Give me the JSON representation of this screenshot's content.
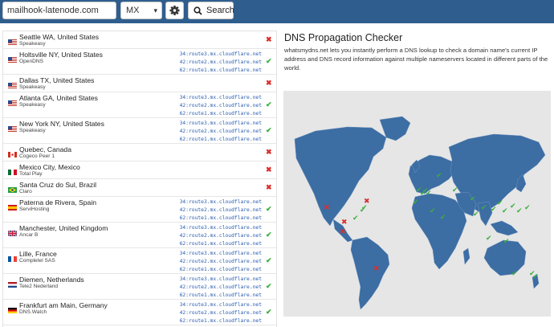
{
  "search": {
    "domain_value": "mailhook-latenode.com",
    "record_type": "MX",
    "search_label": "Search"
  },
  "results": [
    {
      "location": "Seattle WA, United States",
      "isp": "Speakeasy",
      "flag": "us",
      "records": [],
      "status": "fail"
    },
    {
      "location": "Holtsville NY, United States",
      "isp": "OpenDNS",
      "flag": "us",
      "records": [
        "34:route3.mx.cloudflare.net",
        "42:route2.mx.cloudflare.net",
        "62:route1.mx.cloudflare.net"
      ],
      "status": "ok"
    },
    {
      "location": "Dallas TX, United States",
      "isp": "Speakeasy",
      "flag": "us",
      "records": [],
      "status": "fail"
    },
    {
      "location": "Atlanta GA, United States",
      "isp": "Speakeasy",
      "flag": "us",
      "records": [
        "34:route3.mx.cloudflare.net",
        "42:route2.mx.cloudflare.net",
        "62:route1.mx.cloudflare.net"
      ],
      "status": "ok"
    },
    {
      "location": "New York NY, United States",
      "isp": "Speakeasy",
      "flag": "us",
      "records": [
        "34:route3.mx.cloudflare.net",
        "42:route2.mx.cloudflare.net",
        "62:route1.mx.cloudflare.net"
      ],
      "status": "ok"
    },
    {
      "location": "Quebec, Canada",
      "isp": "Cogeco Peer 1",
      "flag": "ca",
      "records": [],
      "status": "fail"
    },
    {
      "location": "Mexico City, Mexico",
      "isp": "Total Play",
      "flag": "mx",
      "records": [],
      "status": "fail"
    },
    {
      "location": "Santa Cruz do Sul, Brazil",
      "isp": "Claro",
      "flag": "br",
      "records": [],
      "status": "fail"
    },
    {
      "location": "Paterna de Rivera, Spain",
      "isp": "ServiHosting",
      "flag": "es",
      "records": [
        "34:route3.mx.cloudflare.net",
        "42:route2.mx.cloudflare.net",
        "62:route1.mx.cloudflare.net"
      ],
      "status": "ok"
    },
    {
      "location": "Manchester, United Kingdom",
      "isp": "Ancar B",
      "flag": "gb",
      "records": [
        "34:route3.mx.cloudflare.net",
        "42:route2.mx.cloudflare.net",
        "62:route1.mx.cloudflare.net"
      ],
      "status": "ok"
    },
    {
      "location": "Lille, France",
      "isp": "Completel SAS",
      "flag": "fr",
      "records": [
        "34:route3.mx.cloudflare.net",
        "42:route2.mx.cloudflare.net",
        "62:route1.mx.cloudflare.net"
      ],
      "status": "ok"
    },
    {
      "location": "Diemen, Netherlands",
      "isp": "Tele2 Nederland",
      "flag": "nl",
      "records": [
        "34:route3.mx.cloudflare.net",
        "42:route2.mx.cloudflare.net",
        "62:route1.mx.cloudflare.net"
      ],
      "status": "ok"
    },
    {
      "location": "Frankfurt am Main, Germany",
      "isp": "DNS.Watch",
      "flag": "de",
      "records": [
        "34:route3.mx.cloudflare.net",
        "42:route2.mx.cloudflare.net",
        "62:route1.mx.cloudflare.net"
      ],
      "status": "ok"
    }
  ],
  "info": {
    "title": "DNS Propagation Checker",
    "description": "whatsmydns.net lets you instantly perform a DNS lookup to check a domain name's current IP address and DNS record information against multiple nameservers located in different parts of the world."
  },
  "colors": {
    "topbar": "#2f5e8e",
    "map_land": "#3c6da3",
    "ok": "#3cae3c",
    "fail": "#d9302e",
    "record_link": "#2a5db0"
  },
  "icons": {
    "settings": "gear-icon",
    "search": "search-icon",
    "ok": "check-icon",
    "fail": "cross-icon"
  }
}
